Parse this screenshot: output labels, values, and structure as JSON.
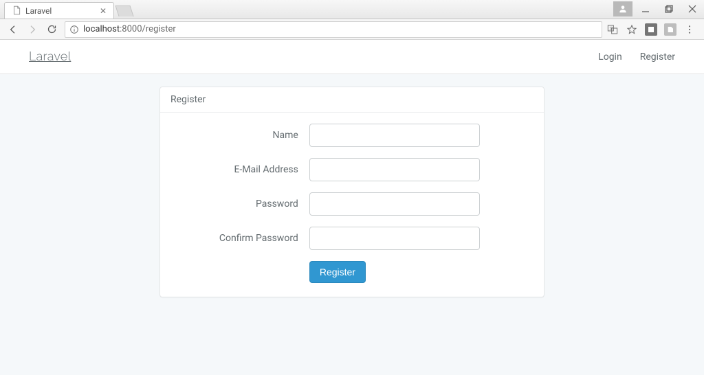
{
  "browser": {
    "tab_title": "Laravel",
    "url_display": {
      "host": "localhost",
      "port": ":8000",
      "path": "/register"
    },
    "window_controls": {
      "user": "user-icon",
      "minimize": "minimize-icon",
      "maximize": "maximize-icon",
      "close": "close-icon"
    },
    "addr_icons": {
      "translate": "translate-icon",
      "star": "star-icon",
      "ext1": "extension-icon",
      "ext2": "pdf-icon",
      "menu": "kebab-icon"
    }
  },
  "navbar": {
    "brand": "Laravel",
    "links": {
      "login": "Login",
      "register": "Register"
    }
  },
  "panel": {
    "heading": "Register",
    "form": {
      "name_label": "Name",
      "email_label": "E-Mail Address",
      "password_label": "Password",
      "confirm_label": "Confirm Password",
      "submit_label": "Register",
      "values": {
        "name": "",
        "email": "",
        "password": "",
        "confirm": ""
      }
    }
  }
}
